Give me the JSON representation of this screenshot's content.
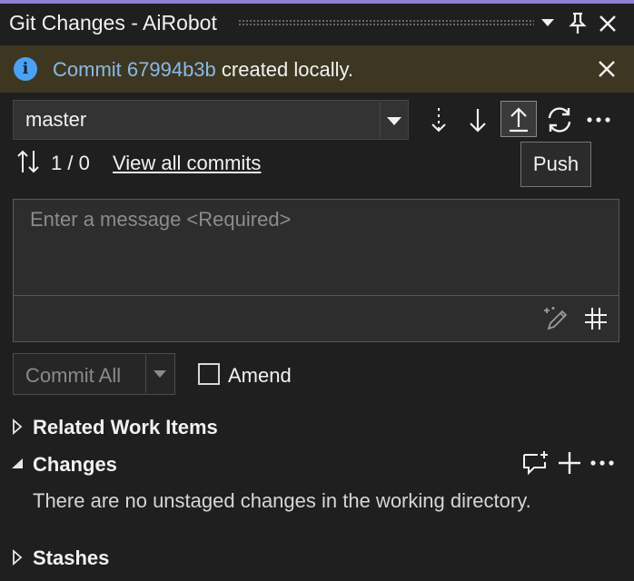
{
  "window": {
    "title": "Git Changes - AiRobot"
  },
  "infobar": {
    "commit_link": "Commit 67994b3b",
    "message": " created locally."
  },
  "branch": {
    "selected": "master"
  },
  "toolbar": {
    "tooltip": "Push"
  },
  "sync": {
    "counts": "1 / 0",
    "view_all": "View all commits"
  },
  "commit_message": {
    "placeholder": "Enter a message <Required>"
  },
  "commit": {
    "button_label": "Commit All",
    "amend_label": "Amend"
  },
  "sections": {
    "related_work_items": "Related Work Items",
    "changes": "Changes",
    "changes_empty": "There are no unstaged changes in the working directory.",
    "stashes": "Stashes"
  },
  "icons": {
    "info": "info-icon",
    "dropdown": "chevron-down-icon",
    "pin": "pin-icon",
    "close": "close-icon",
    "fetch": "fetch-icon",
    "pull": "pull-icon",
    "push": "push-icon",
    "sync": "sync-icon",
    "more": "more-icon",
    "incoming_outgoing": "arrows-up-down-icon",
    "ai": "ai-sparkle-pen-icon",
    "reference": "hash-icon",
    "ai_review": "chat-sparkle-icon",
    "stage_all": "plus-icon"
  },
  "colors": {
    "accent": "#8b7fd6",
    "info_bg": "#3d3722",
    "info_icon": "#4aa2f5",
    "link": "#8ab9e8",
    "background": "#1f1f1f"
  }
}
